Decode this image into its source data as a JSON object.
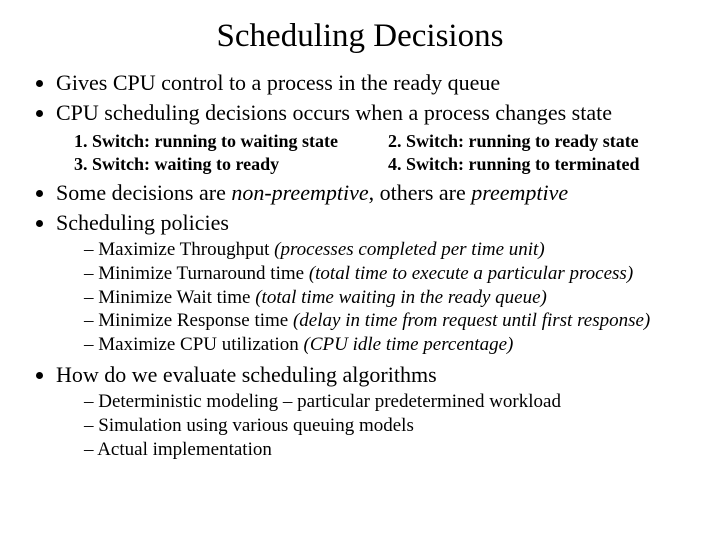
{
  "title": "Scheduling Decisions",
  "b1": "Gives CPU control to a process in the ready queue",
  "b2": "CPU scheduling decisions occurs when a process changes state",
  "sw1": "1. Switch: running to waiting state",
  "sw2": "2. Switch: running to ready state",
  "sw3": "3. Switch: waiting to ready",
  "sw4": "4. Switch: running to terminated",
  "b3a": "Some decisions are ",
  "b3b": "non-preemptive",
  "b3c": ", others are ",
  "b3d": "preemptive",
  "b4": "Scheduling policies",
  "p1a": "Maximize Throughput ",
  "p1b": "(processes completed per time unit)",
  "p2a": "Minimize Turnaround time  ",
  "p2b": "(total time to execute a particular process)",
  "p3a": "Minimize Wait time  ",
  "p3b": "(total time waiting in the ready queue)",
  "p4a": "Minimize Response time  ",
  "p4b": "(delay in time from request until first response)",
  "p5a": "Maximize CPU utilization ",
  "p5b": "(CPU idle time percentage)",
  "b5": "How do we evaluate scheduling algorithms",
  "e1": "Deterministic modeling – particular predetermined workload",
  "e2": "Simulation using various queuing models",
  "e3": "Actual implementation"
}
